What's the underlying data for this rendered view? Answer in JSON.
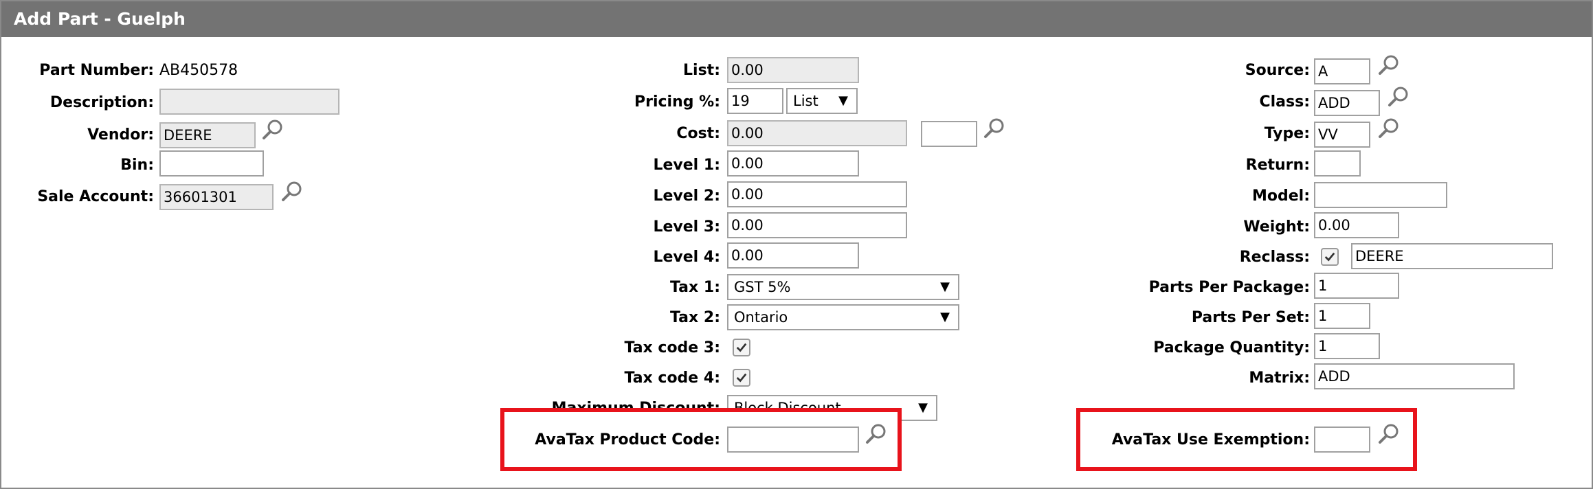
{
  "window": {
    "title": "Add Part -  Guelph"
  },
  "left": {
    "part_number_label": "Part Number:",
    "part_number_value": "AB450578",
    "description_label": "Description:",
    "description_value": "",
    "vendor_label": "Vendor:",
    "vendor_value": "DEERE",
    "bin_label": "Bin:",
    "bin_value": "",
    "sale_account_label": "Sale Account:",
    "sale_account_value": "36601301"
  },
  "middle": {
    "list_label": "List:",
    "list_value": "0.00",
    "pricing_label": "Pricing %:",
    "pricing_value": "19",
    "pricing_basis": "List",
    "cost_label": "Cost:",
    "cost_value": "0.00",
    "cost_extra_value": "",
    "level1_label": "Level 1:",
    "level1_value": "0.00",
    "level2_label": "Level 2:",
    "level2_value": "0.00",
    "level3_label": "Level 3:",
    "level3_value": "0.00",
    "level4_label": "Level 4:",
    "level4_value": "0.00",
    "tax1_label": "Tax 1:",
    "tax1_value": "GST 5%",
    "tax2_label": "Tax 2:",
    "tax2_value": "Ontario",
    "taxcode3_label": "Tax code 3:",
    "taxcode3_checked": true,
    "taxcode4_label": "Tax code 4:",
    "taxcode4_checked": true,
    "max_discount_label": "Maximum Discount:",
    "max_discount_value": "Block Discount",
    "avatax_product_label": "AvaTax Product Code:",
    "avatax_product_value": ""
  },
  "right": {
    "source_label": "Source:",
    "source_value": "A",
    "class_label": "Class:",
    "class_value": "ADD",
    "type_label": "Type:",
    "type_value": "VV",
    "return_label": "Return:",
    "return_value": "",
    "model_label": "Model:",
    "model_value": "",
    "weight_label": "Weight:",
    "weight_value": "0.00",
    "reclass_label": "Reclass:",
    "reclass_checked": true,
    "reclass_value": "DEERE",
    "ppp_label": "Parts Per Package:",
    "ppp_value": "1",
    "pps_label": "Parts Per Set:",
    "pps_value": "1",
    "pkgqty_label": "Package Quantity:",
    "pkgqty_value": "1",
    "matrix_label": "Matrix:",
    "matrix_value": "ADD",
    "avatax_exemption_label": "AvaTax Use Exemption:",
    "avatax_exemption_value": ""
  },
  "icons": {
    "lookup": "magnifier-icon",
    "check": "checkmark-icon",
    "dropdown": "triangle-down-icon"
  },
  "colors": {
    "titlebar": "#737373",
    "highlight": "#e8131b",
    "readonly_bg": "#ececec"
  }
}
